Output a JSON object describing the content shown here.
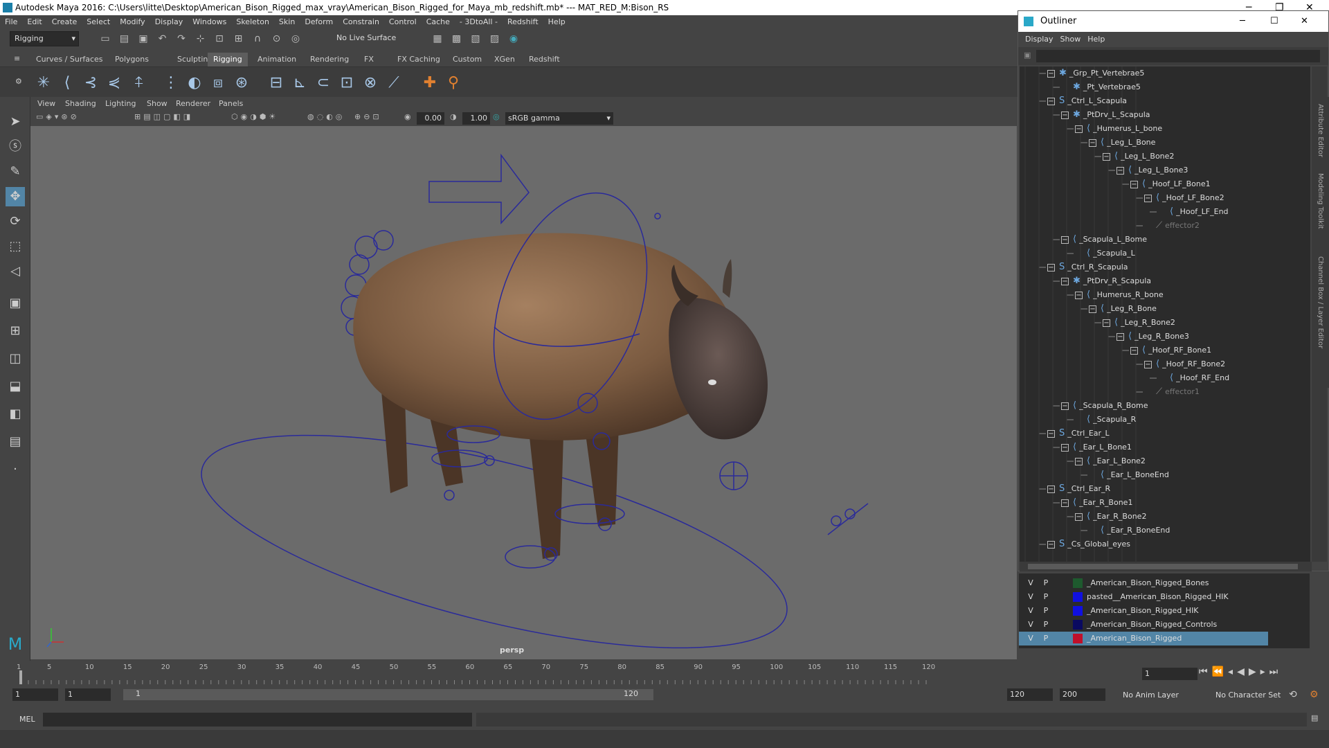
{
  "window": {
    "title": "Autodesk Maya 2016: C:\\Users\\litte\\Desktop\\American_Bison_Rigged_max_vray\\American_Bison_Rigged_for_Maya_mb_redshift.mb*  ---  MAT_RED_M:Bison_RS"
  },
  "menu": [
    "File",
    "Edit",
    "Create",
    "Select",
    "Modify",
    "Display",
    "Windows",
    "Skeleton",
    "Skin",
    "Deform",
    "Constrain",
    "Control",
    "Cache",
    "- 3DtoAll -",
    "Redshift",
    "Help"
  ],
  "status": {
    "mode": "Rigging",
    "live_surface": "No Live Surface"
  },
  "shelf_tabs": [
    "Curves / Surfaces",
    "Polygons",
    "Sculpting",
    "Rigging",
    "Animation",
    "Rendering",
    "FX",
    "FX Caching",
    "Custom",
    "XGen",
    "Redshift"
  ],
  "active_shelf": "Rigging",
  "panel_menu": [
    "View",
    "Shading",
    "Lighting",
    "Show",
    "Renderer",
    "Panels"
  ],
  "panel_tool": {
    "exposure": "0.00",
    "gamma": "1.00",
    "colorspace": "sRGB gamma"
  },
  "viewport": {
    "camera_label": "persp"
  },
  "timeline": {
    "ticks": [
      "1",
      "5",
      "10",
      "15",
      "20",
      "25",
      "30",
      "35",
      "40",
      "45",
      "50",
      "55",
      "60",
      "65",
      "70",
      "75",
      "80",
      "85",
      "90",
      "95",
      "100",
      "105",
      "110",
      "115",
      "120"
    ],
    "current_frame": "1"
  },
  "range": {
    "start": "1",
    "start2": "1",
    "slider_start": "1",
    "slider_end": "120",
    "end": "120",
    "end2": "200",
    "anim_layer": "No Anim Layer",
    "char_set": "No Character Set"
  },
  "cmdline": {
    "label": "MEL"
  },
  "outliner": {
    "title": "Outliner",
    "menu": [
      "Display",
      "Show",
      "Help"
    ],
    "rows": [
      {
        "depth": 3,
        "exp": "-",
        "icon": "joint",
        "label": "_Grp_Pt_Vertebrae5"
      },
      {
        "depth": 4,
        "exp": "",
        "icon": "joint",
        "label": "_Pt_Vertebrae5"
      },
      {
        "depth": 3,
        "exp": "-",
        "icon": "curve",
        "label": "_Ctrl_L_Scapula"
      },
      {
        "depth": 4,
        "exp": "-",
        "icon": "joint",
        "label": "_PtDrv_L_Scapula"
      },
      {
        "depth": 5,
        "exp": "-",
        "icon": "bone",
        "label": "_Humerus_L_bone"
      },
      {
        "depth": 6,
        "exp": "-",
        "icon": "bone",
        "label": "_Leg_L_Bone"
      },
      {
        "depth": 7,
        "exp": "-",
        "icon": "bone",
        "label": "_Leg_L_Bone2"
      },
      {
        "depth": 8,
        "exp": "-",
        "icon": "bone",
        "label": "_Leg_L_Bone3"
      },
      {
        "depth": 9,
        "exp": "-",
        "icon": "bone",
        "label": "_Hoof_LF_Bone1"
      },
      {
        "depth": 10,
        "exp": "-",
        "icon": "bone",
        "label": "_Hoof_LF_Bone2"
      },
      {
        "depth": 11,
        "exp": "",
        "icon": "bone",
        "label": "_Hoof_LF_End"
      },
      {
        "depth": 10,
        "exp": "",
        "icon": "effector",
        "label": "effector2",
        "faded": true
      },
      {
        "depth": 4,
        "exp": "-",
        "icon": "bone",
        "label": "_Scapula_L_Bome"
      },
      {
        "depth": 5,
        "exp": "",
        "icon": "bone",
        "label": "_Scapula_L"
      },
      {
        "depth": 3,
        "exp": "-",
        "icon": "curve",
        "label": "_Ctrl_R_Scapula"
      },
      {
        "depth": 4,
        "exp": "-",
        "icon": "joint",
        "label": "_PtDrv_R_Scapula"
      },
      {
        "depth": 5,
        "exp": "-",
        "icon": "bone",
        "label": "_Humerus_R_bone"
      },
      {
        "depth": 6,
        "exp": "-",
        "icon": "bone",
        "label": "_Leg_R_Bone"
      },
      {
        "depth": 7,
        "exp": "-",
        "icon": "bone",
        "label": "_Leg_R_Bone2"
      },
      {
        "depth": 8,
        "exp": "-",
        "icon": "bone",
        "label": "_Leg_R_Bone3"
      },
      {
        "depth": 9,
        "exp": "-",
        "icon": "bone",
        "label": "_Hoof_RF_Bone1"
      },
      {
        "depth": 10,
        "exp": "-",
        "icon": "bone",
        "label": "_Hoof_RF_Bone2"
      },
      {
        "depth": 11,
        "exp": "",
        "icon": "bone",
        "label": "_Hoof_RF_End"
      },
      {
        "depth": 10,
        "exp": "",
        "icon": "effector",
        "label": "effector1",
        "faded": true
      },
      {
        "depth": 4,
        "exp": "-",
        "icon": "bone",
        "label": "_Scapula_R_Bome"
      },
      {
        "depth": 5,
        "exp": "",
        "icon": "bone",
        "label": "_Scapula_R"
      },
      {
        "depth": 3,
        "exp": "-",
        "icon": "curve",
        "label": "_Ctrl_Ear_L"
      },
      {
        "depth": 4,
        "exp": "-",
        "icon": "bone",
        "label": "_Ear_L_Bone1"
      },
      {
        "depth": 5,
        "exp": "-",
        "icon": "bone",
        "label": "_Ear_L_Bone2"
      },
      {
        "depth": 6,
        "exp": "",
        "icon": "bone",
        "label": "_Ear_L_BoneEnd"
      },
      {
        "depth": 3,
        "exp": "-",
        "icon": "curve",
        "label": "_Ctrl_Ear_R"
      },
      {
        "depth": 4,
        "exp": "-",
        "icon": "bone",
        "label": "_Ear_R_Bone1"
      },
      {
        "depth": 5,
        "exp": "-",
        "icon": "bone",
        "label": "_Ear_R_Bone2"
      },
      {
        "depth": 6,
        "exp": "",
        "icon": "bone",
        "label": "_Ear_R_BoneEnd"
      },
      {
        "depth": 3,
        "exp": "-",
        "icon": "curve",
        "label": "_Cs_Global_eyes"
      }
    ]
  },
  "layers": [
    {
      "v": "V",
      "p": "P",
      "color": "#1e5a2e",
      "name": "_American_Bison_Rigged_Bones"
    },
    {
      "v": "V",
      "p": "P",
      "color": "#1010e0",
      "name": "pasted__American_Bison_Rigged_HIK"
    },
    {
      "v": "V",
      "p": "P",
      "color": "#1010e0",
      "name": "_American_Bison_Rigged_HIK"
    },
    {
      "v": "V",
      "p": "P",
      "color": "#0a0a60",
      "name": "_American_Bison_Rigged_Controls"
    },
    {
      "v": "V",
      "p": "P",
      "color": "#c0102a",
      "name": "_American_Bison_Rigged",
      "selected": true
    }
  ],
  "right_strip": [
    "Attribute Editor",
    "Modeling Toolkit",
    "Channel Box / Layer Editor"
  ],
  "colors": {
    "accent": "#5285a6",
    "rig_curve": "#2a2a9a",
    "fur": "#7a5a40"
  }
}
